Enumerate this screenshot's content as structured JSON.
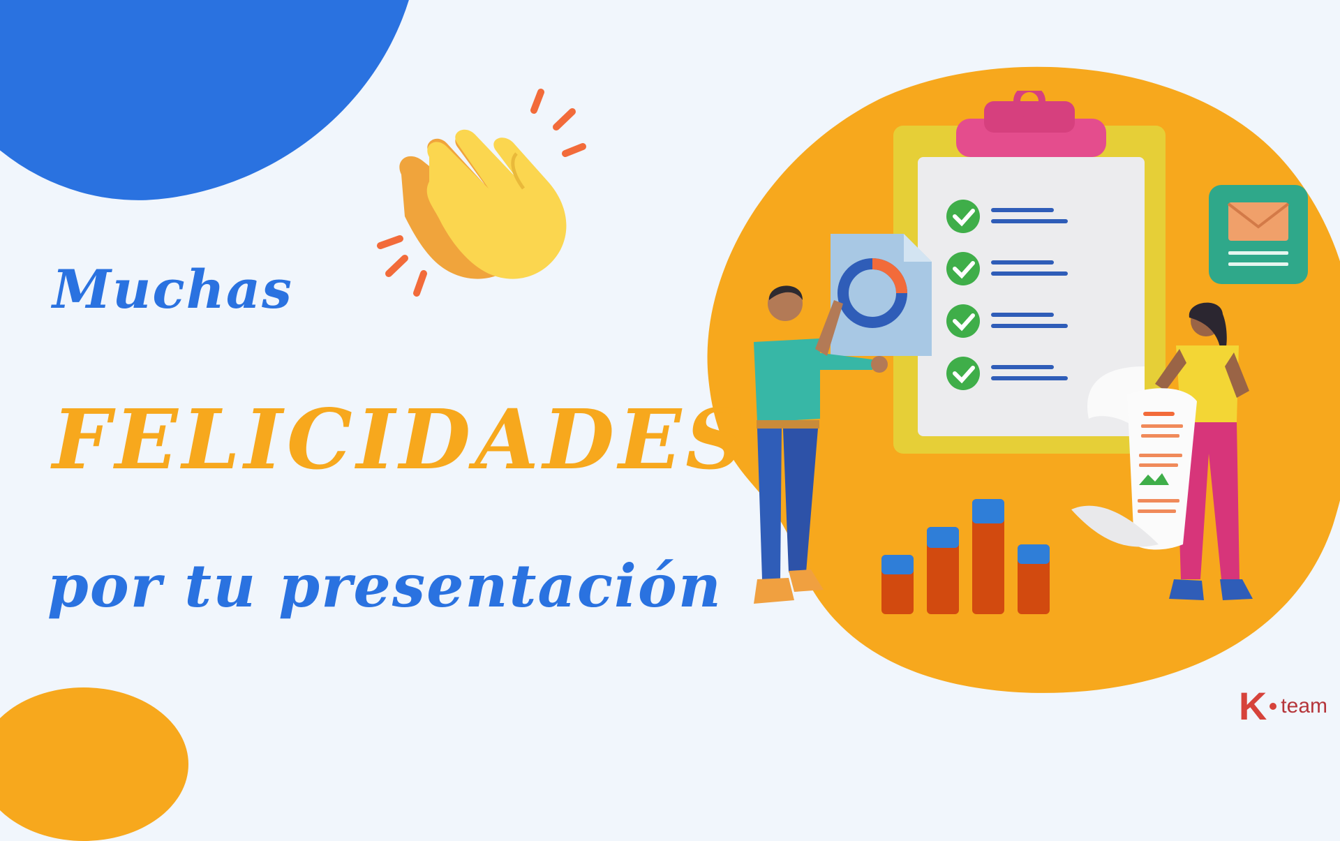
{
  "headline": {
    "line1": "Muchas",
    "line2": "FELICIDADES",
    "line3": "por tu presentación"
  },
  "logo": {
    "letter": "K",
    "word": "team"
  },
  "colors": {
    "background": "#f1f6fc",
    "blue": "#2a72e0",
    "orange": "#f7a81d",
    "brand_red": "#d6433b"
  },
  "icons": [
    "clapping-hands-icon",
    "clipboard-checklist-icon",
    "donut-chart-icon",
    "envelope-icon",
    "bar-chart-icon",
    "receipt-icon"
  ]
}
